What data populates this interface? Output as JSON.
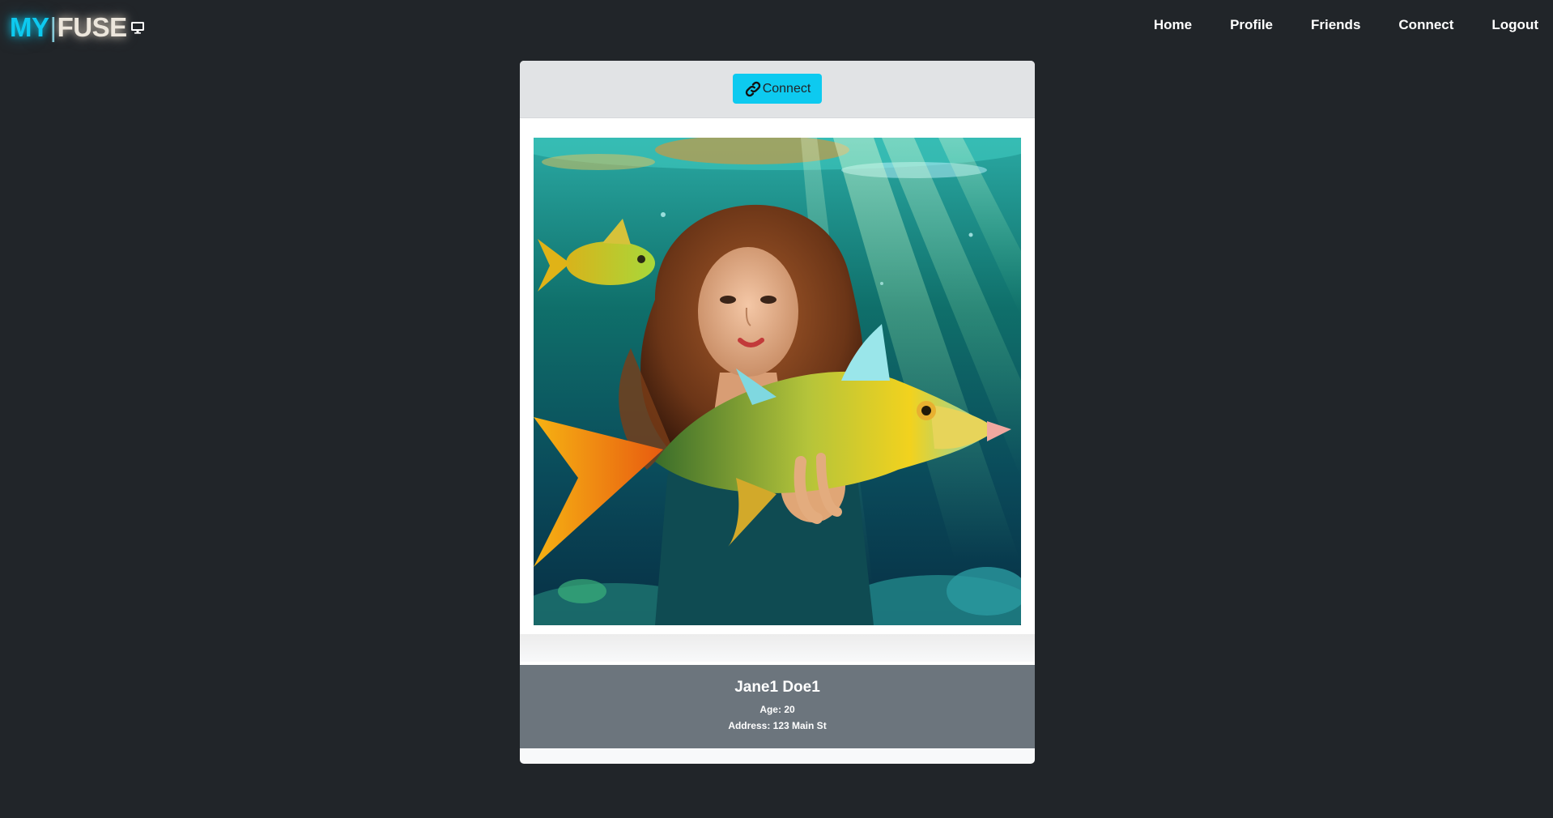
{
  "navbar": {
    "brand_my": "MY",
    "brand_separator": "|",
    "brand_fuse": "FUSE",
    "brand_icon": "monitor-icon",
    "links": [
      "Home",
      "Profile",
      "Friends",
      "Connect",
      "Logout"
    ]
  },
  "card": {
    "connect_button_label": "Connect",
    "connect_button_icon": "link-icon",
    "photo_alt": "",
    "name": "Jane1 Doe1",
    "age_line": "Age: 20",
    "address_line": "Address: 123 Main St"
  },
  "colors": {
    "background": "#212529",
    "accent": "#0dcaf0",
    "card_header": "#e1e3e5",
    "info_panel": "#6c757d"
  }
}
